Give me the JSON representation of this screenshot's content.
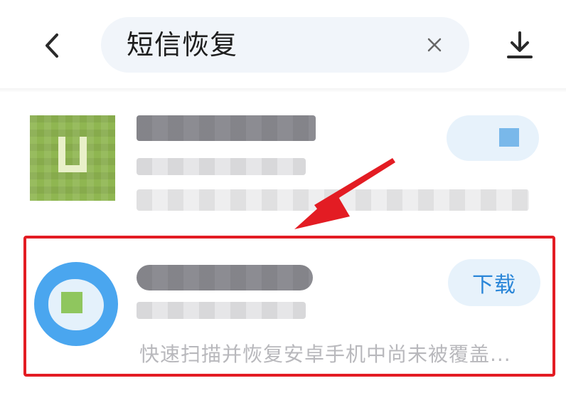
{
  "header": {
    "back_icon": "chevron-left-icon",
    "search_query": "短信恢复",
    "clear_icon": "close-icon",
    "download_icon": "download-icon"
  },
  "results": [
    {
      "icon": "app-icon-green-square",
      "title": "",
      "meta": "",
      "description": "",
      "button_label": ""
    },
    {
      "icon": "app-icon-blue-circle",
      "title": "",
      "meta": "",
      "description": "快速扫描并恢复安卓手机中尚未被覆盖...",
      "button_label": "下载"
    }
  ],
  "colors": {
    "accent": "#2a86d8",
    "highlight": "#e31c23",
    "search_bg": "#f1f5fa",
    "button_bg": "#e7f2fb"
  }
}
